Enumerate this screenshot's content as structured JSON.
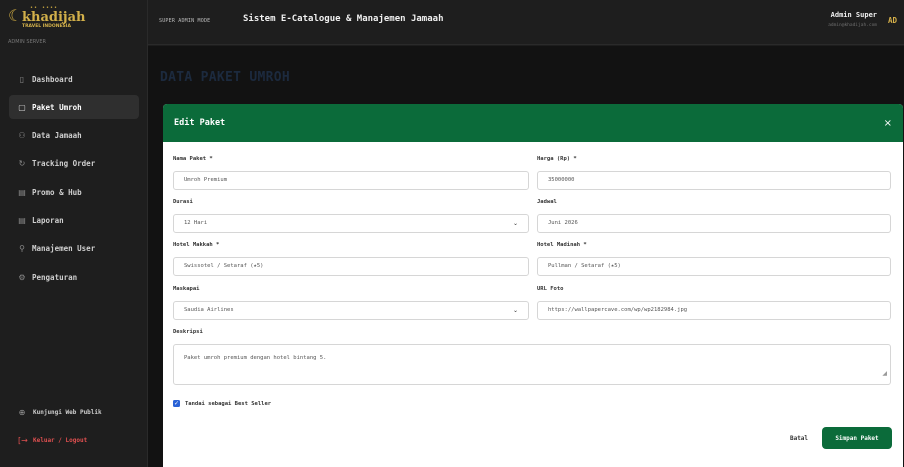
{
  "brand": {
    "dots": "•• ••••",
    "name": "khadijah",
    "subtitle": "TRAVEL INDONESIA",
    "server_label": "ADMIN SERVER"
  },
  "sidebar": {
    "items": [
      {
        "label": "Dashboard",
        "icon": "dashboard-icon",
        "glyph": "▯",
        "active": false
      },
      {
        "label": "Paket Umroh",
        "icon": "package-icon",
        "glyph": "▢",
        "active": true
      },
      {
        "label": "Data Jamaah",
        "icon": "users-icon",
        "glyph": "⚇",
        "active": false
      },
      {
        "label": "Tracking Order",
        "icon": "refresh-icon",
        "glyph": "↻",
        "active": false
      },
      {
        "label": "Promo & Hub",
        "icon": "document-icon",
        "glyph": "▤",
        "active": false
      },
      {
        "label": "Laporan",
        "icon": "report-icon",
        "glyph": "▤",
        "active": false
      },
      {
        "label": "Manajemen User",
        "icon": "user-admin-icon",
        "glyph": "⚲",
        "active": false
      },
      {
        "label": "Pengaturan",
        "icon": "gear-icon",
        "glyph": "⚙",
        "active": false
      }
    ],
    "visit_site": {
      "label": "Kunjungi Web Publik",
      "icon": "globe-icon",
      "glyph": "⊕"
    },
    "logout": {
      "label": "Keluar / Logout",
      "icon": "logout-icon",
      "glyph": "[→"
    }
  },
  "topbar": {
    "mode": "SUPER ADMIN MODE",
    "title": "Sistem E-Catalogue & Manajemen Jamaah",
    "user_name": "Admin Super",
    "user_email": "admin@khadijah.com",
    "avatar": "AD"
  },
  "page": {
    "heading": "DATA PAKET UMROH"
  },
  "modal": {
    "title": "Edit Paket",
    "close_glyph": "×",
    "fields": {
      "nama_paket": {
        "label": "Nama Paket *",
        "value": "Umroh Premium"
      },
      "harga": {
        "label": "Harga (Rp) *",
        "value": "35000000"
      },
      "durasi": {
        "label": "Durasi",
        "value": "12 Hari"
      },
      "jadwal": {
        "label": "Jadwal",
        "value": "Juni 2026"
      },
      "hotel_makkah": {
        "label": "Hotel Makkah *",
        "value": "Swissotel / Setaraf (★5)"
      },
      "hotel_madinah": {
        "label": "Hotel Madinah *",
        "value": "Pullman / Setaraf (★5)"
      },
      "maskapai": {
        "label": "Maskapai",
        "value": "Saudia Airlines"
      },
      "url_foto": {
        "label": "URL Foto",
        "value": "https://wallpapercave.com/wp/wp2182984.jpg"
      },
      "deskripsi": {
        "label": "Deskripsi",
        "value": "Paket umroh premium dengan hotel bintang 5."
      }
    },
    "best_seller": {
      "label": "Tandai sebagai Best Seller",
      "checked": true
    },
    "cancel_label": "Batal",
    "save_label": "Simpan Paket"
  },
  "colors": {
    "accent_green": "#0b6b3a",
    "brand_gold": "#d2b04a",
    "checkbox_blue": "#2a62d6",
    "logout_red": "#e05050"
  }
}
